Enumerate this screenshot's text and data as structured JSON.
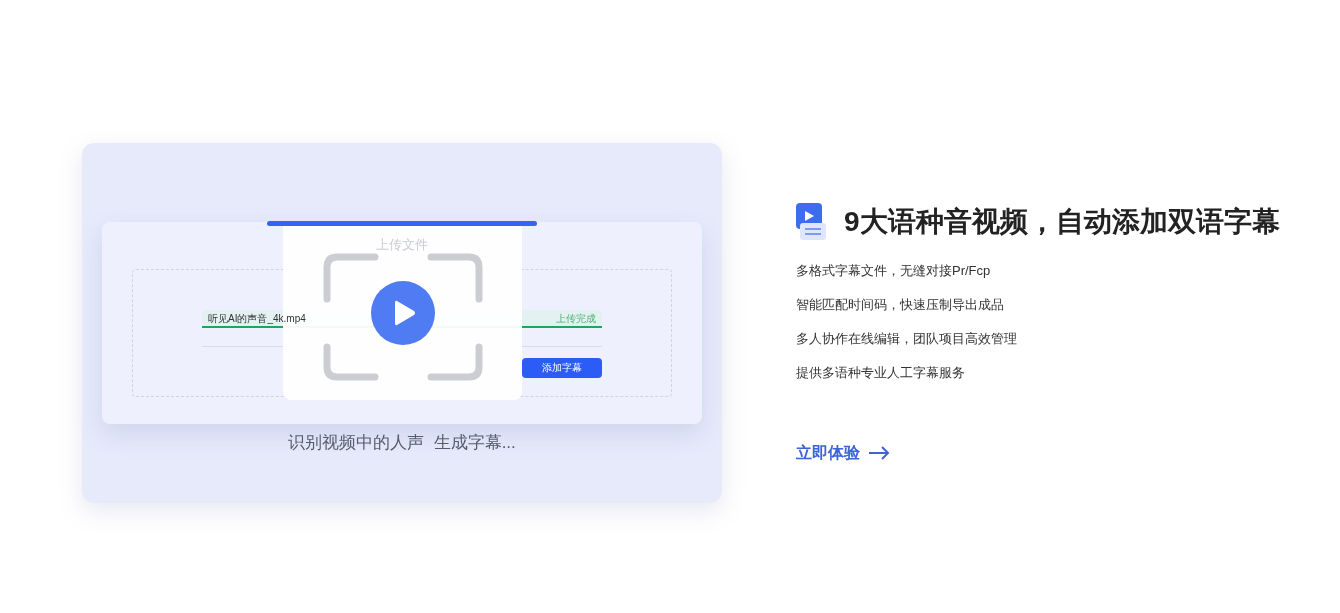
{
  "illustration": {
    "dialog_title": "上传文件",
    "file": {
      "name": "听见AI的声音_4k.mp4",
      "status": "上传完成",
      "level": 1
    },
    "button": "添加字幕",
    "caption": "识别视频中的人声  生成字幕..."
  },
  "feature": {
    "title": "9大语种音视频，自动添加双语字幕",
    "bullets": [
      "多格式字幕文件，无缝对接Pr/Fcp",
      "智能匹配时间码，快速压制导出成品",
      "多人协作在线编辑，团队项目高效管理",
      "提供多语种专业人工字幕服务"
    ],
    "link": "立即体验"
  }
}
